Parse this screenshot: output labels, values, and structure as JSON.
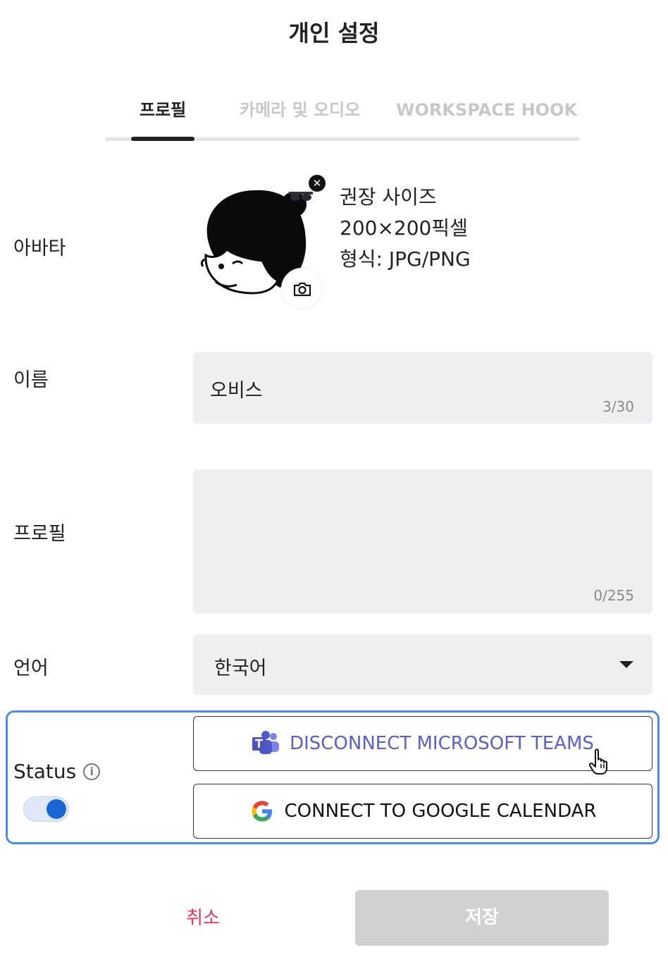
{
  "dialog": {
    "title": "개인 설정"
  },
  "tabs": [
    {
      "label": "프로필",
      "active": true
    },
    {
      "label": "카메라 및 오디오",
      "active": false
    },
    {
      "label": "WORKSPACE HOOK",
      "active": false
    }
  ],
  "avatar": {
    "label": "아바타",
    "hint_lines": [
      "권장 사이즈",
      "200×200픽셀",
      "형식: JPG/PNG"
    ],
    "remove_icon": "close-icon",
    "upload_icon": "camera-icon"
  },
  "name": {
    "label": "이름",
    "value": "오비스",
    "counter": "3/30"
  },
  "profile": {
    "label": "프로필",
    "value": "",
    "counter": "0/255"
  },
  "language": {
    "label": "언어",
    "selected": "한국어"
  },
  "status": {
    "label": "Status",
    "info_icon": "info-icon",
    "toggle_on": true,
    "teams_button": "DISCONNECT MICROSOFT TEAMS",
    "google_button": "CONNECT TO GOOGLE CALENDAR"
  },
  "footer": {
    "cancel": "취소",
    "save": "저장"
  },
  "colors": {
    "accent_blue": "#4a8de8",
    "toggle_blue": "#1967d2",
    "teams_purple": "#5b5fc7",
    "cancel_pink": "#e8365d",
    "disabled_gray": "#d1d1d5",
    "field_bg": "#efeef2"
  }
}
